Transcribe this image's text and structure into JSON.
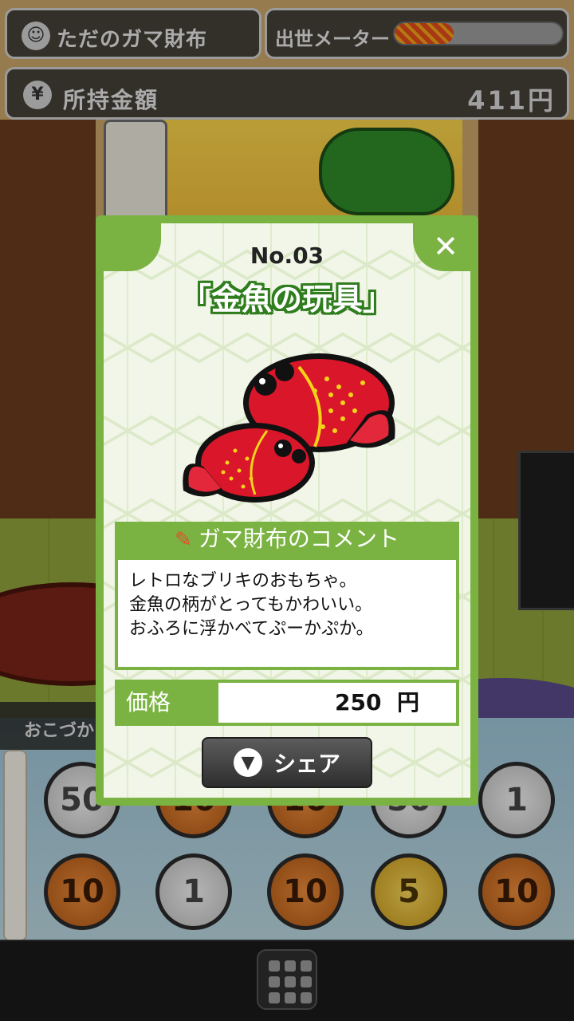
{
  "hud": {
    "wallet_name": "ただのガマ財布",
    "meter_label": "出世メーター",
    "meter_progress": 0.35,
    "money_label": "所持金額",
    "money_value": "411円"
  },
  "background": {
    "tray_label": "おこづか",
    "coins": [
      {
        "value": "50",
        "kind": "silver"
      },
      {
        "value": "10",
        "kind": "copper"
      },
      {
        "value": "10",
        "kind": "copper"
      },
      {
        "value": "50",
        "kind": "silver"
      },
      {
        "value": "1",
        "kind": "silver"
      },
      {
        "value": "10",
        "kind": "copper"
      },
      {
        "value": "1",
        "kind": "silver"
      },
      {
        "value": "10",
        "kind": "copper"
      },
      {
        "value": "5",
        "kind": "gold"
      },
      {
        "value": "10",
        "kind": "copper"
      }
    ]
  },
  "card": {
    "number": "No.03",
    "name": "「金魚の玩具」",
    "comment_heading": "ガマ財布のコメント",
    "comment_lines": [
      "レトロなブリキのおもちゃ。",
      "金魚の柄がとってもかわいい。",
      "おふろに浮かべてぷーかぷか。"
    ],
    "price_label": "価格",
    "price_value": "250",
    "price_unit": "円",
    "share_label": "シェア",
    "close_icon": "close-icon"
  },
  "colors": {
    "card_green": "#7ab342",
    "title_outline": "#2f7d1e",
    "fish_red": "#d9162a",
    "fish_dots": "#f5d21a"
  }
}
